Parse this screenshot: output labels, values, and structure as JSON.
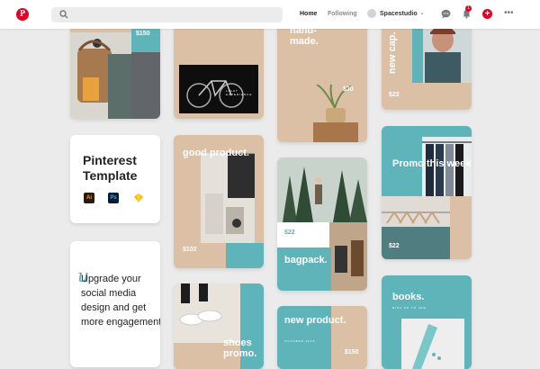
{
  "topbar": {
    "logo_letter": "P",
    "nav_home": "Home",
    "nav_following": "Following",
    "profile_name": "Spacestudio",
    "notification_count": "1"
  },
  "pins": {
    "bag": {
      "price": "$150"
    },
    "bike": {
      "caption": "LIGHT EXPERIENCE"
    },
    "handmade": {
      "headline": "hand-\nmade.",
      "price": "$30"
    },
    "newcap": {
      "headline": "new cap.",
      "price": "$22"
    },
    "template": {
      "title_line1": "Pinterest",
      "title_line2": "Template",
      "apps": [
        "Ai",
        "Ps",
        "Sketch"
      ]
    },
    "goodproduct": {
      "headline": "good product.",
      "price": "$102"
    },
    "bagpack": {
      "headline": "bagpack.",
      "price": "$22"
    },
    "promo": {
      "headline": "Promo this week",
      "price": "$22"
    },
    "cta": {
      "text": "Upgrade your social media design and get more engagement"
    },
    "shoes": {
      "headline": "shoes promo."
    },
    "newproduct": {
      "headline": "new product.",
      "sub": "OCTOBER 2019",
      "price": "$150"
    },
    "books": {
      "headline": "books.",
      "sub": "DISC UP TO 30%"
    }
  },
  "colors": {
    "accent": "#e60023",
    "teal": "#5fb4ba",
    "tan": "#dcc0a6"
  }
}
